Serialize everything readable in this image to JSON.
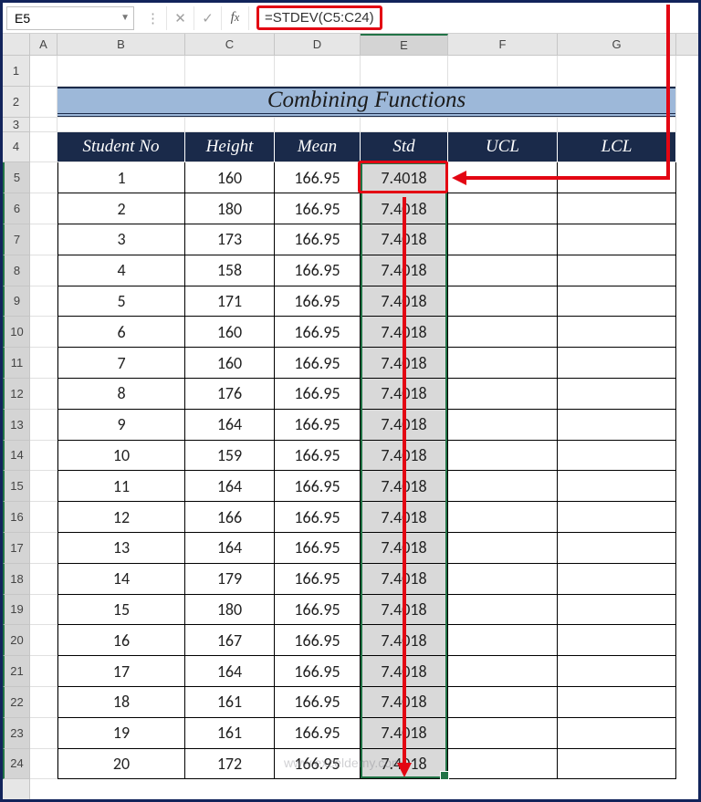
{
  "formula_bar": {
    "cell_ref": "E5",
    "formula": "=STDEV(C5:C24)"
  },
  "columns": [
    "A",
    "B",
    "C",
    "D",
    "E",
    "F",
    "G"
  ],
  "row_numbers": [
    1,
    2,
    3,
    4,
    5,
    6,
    7,
    8,
    9,
    10,
    11,
    12,
    13,
    14,
    15,
    16,
    17,
    18,
    19,
    20,
    21,
    22,
    23,
    24
  ],
  "title": "Combining Functions",
  "headers": {
    "student_no": "Student No",
    "height": "Height",
    "mean": "Mean",
    "std": "Std",
    "ucl": "UCL",
    "lcl": "LCL"
  },
  "rows": [
    {
      "n": "1",
      "h": "160",
      "m": "166.95",
      "s": "7.4018"
    },
    {
      "n": "2",
      "h": "180",
      "m": "166.95",
      "s": "7.4018"
    },
    {
      "n": "3",
      "h": "173",
      "m": "166.95",
      "s": "7.4018"
    },
    {
      "n": "4",
      "h": "158",
      "m": "166.95",
      "s": "7.4018"
    },
    {
      "n": "5",
      "h": "171",
      "m": "166.95",
      "s": "7.4018"
    },
    {
      "n": "6",
      "h": "160",
      "m": "166.95",
      "s": "7.4018"
    },
    {
      "n": "7",
      "h": "160",
      "m": "166.95",
      "s": "7.4018"
    },
    {
      "n": "8",
      "h": "176",
      "m": "166.95",
      "s": "7.4018"
    },
    {
      "n": "9",
      "h": "164",
      "m": "166.95",
      "s": "7.4018"
    },
    {
      "n": "10",
      "h": "159",
      "m": "166.95",
      "s": "7.4018"
    },
    {
      "n": "11",
      "h": "164",
      "m": "166.95",
      "s": "7.4018"
    },
    {
      "n": "12",
      "h": "166",
      "m": "166.95",
      "s": "7.4018"
    },
    {
      "n": "13",
      "h": "164",
      "m": "166.95",
      "s": "7.4018"
    },
    {
      "n": "14",
      "h": "179",
      "m": "166.95",
      "s": "7.4018"
    },
    {
      "n": "15",
      "h": "180",
      "m": "166.95",
      "s": "7.4018"
    },
    {
      "n": "16",
      "h": "167",
      "m": "166.95",
      "s": "7.4018"
    },
    {
      "n": "17",
      "h": "164",
      "m": "166.95",
      "s": "7.4018"
    },
    {
      "n": "18",
      "h": "161",
      "m": "166.95",
      "s": "7.4018"
    },
    {
      "n": "19",
      "h": "161",
      "m": "166.95",
      "s": "7.4018"
    },
    {
      "n": "20",
      "h": "172",
      "m": "166.95",
      "s": "7.4018"
    }
  ],
  "watermark": "www.exceldemy.com"
}
